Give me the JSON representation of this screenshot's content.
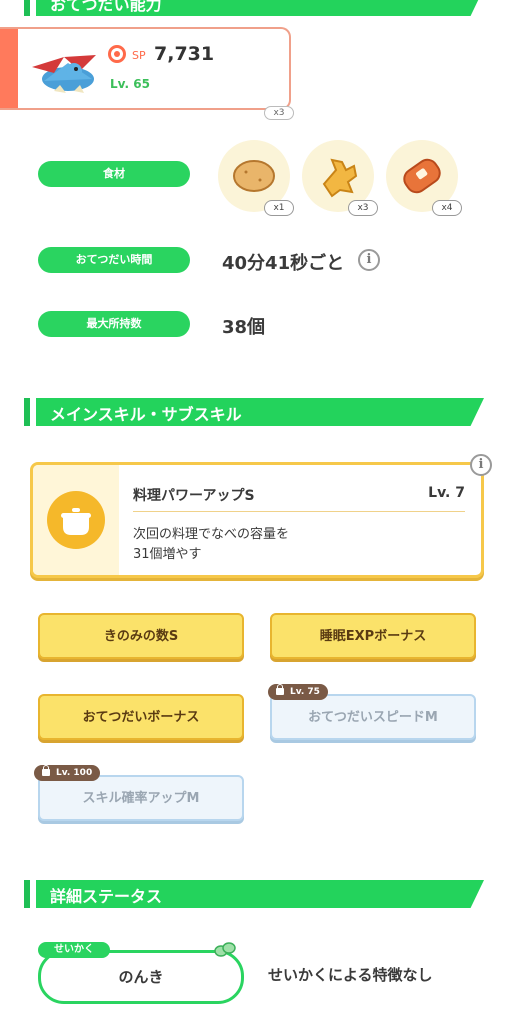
{
  "sections": {
    "help_ability": "おてつだい能力",
    "skills": "メインスキル・サブスキル",
    "detail_status": "詳細ステータス"
  },
  "pokemon": {
    "sp_label": "SP",
    "sp_value": "7,731",
    "level": "Lv. 65",
    "ghost_count": "x3"
  },
  "stats": {
    "ingredients_label": "食材",
    "ingredients": [
      {
        "name": "potato-icon",
        "count": "x1"
      },
      {
        "name": "ginger-icon",
        "count": "x3"
      },
      {
        "name": "sausage-icon",
        "count": "x4"
      }
    ],
    "help_time_label": "おてつだい時間",
    "help_time_value": "40分41秒ごと",
    "max_carry_label": "最大所持数",
    "max_carry_value": "38個"
  },
  "main_skill": {
    "name": "料理パワーアップS",
    "level": "Lv. 7",
    "desc_line1": "次回の料理でなべの容量を",
    "desc_line2": "31個増やす"
  },
  "sub_skills": [
    {
      "label": "きのみの数S",
      "locked": false
    },
    {
      "label": "睡眠EXPボーナス",
      "locked": false
    },
    {
      "label": "おてつだいボーナス",
      "locked": false
    },
    {
      "label": "おてつだいスピードM",
      "locked": true,
      "unlock": "Lv. 75"
    },
    {
      "label": "スキル確率アップM",
      "locked": true,
      "unlock": "Lv. 100"
    }
  ],
  "nature": {
    "tag": "せいかく",
    "value": "のんき",
    "effect": "せいかくによる特徴なし"
  },
  "colors": {
    "green": "#23d35c",
    "sp_orange": "#ff6a4a",
    "skill_gold": "#f5b82a",
    "locked_blue": "#b8d6ee"
  }
}
